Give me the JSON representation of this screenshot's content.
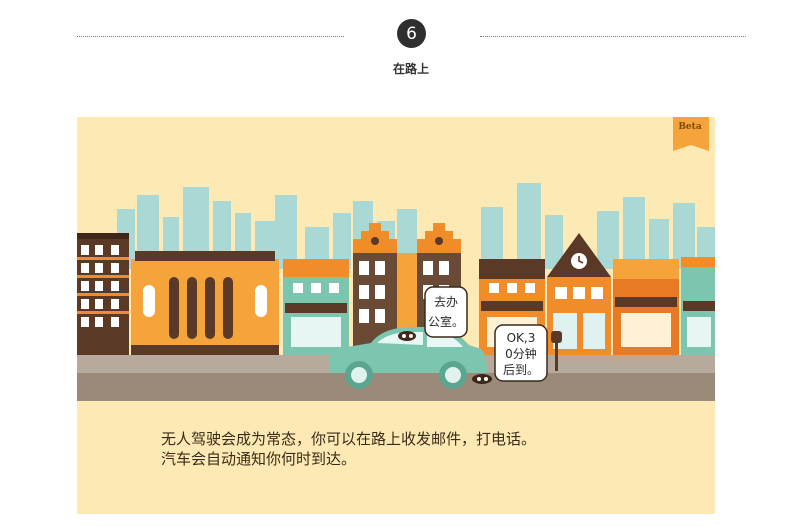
{
  "section": {
    "number": "6",
    "title": "在路上"
  },
  "scene": {
    "badge": "Beta",
    "bubble_left": "去办\n公室。",
    "bubble_right": "OK,3\n0分钟\n后到。",
    "caption_line1": "无人驾驶会成为常态，你可以在路上收发邮件，打电话。",
    "caption_line2": "汽车会自动通知你何时到达。"
  },
  "colors": {
    "background": "#fde9b3",
    "skyline": "#a9d8d5",
    "orange": "#f08c2a",
    "brown": "#5a3a26",
    "car": "#7cc6b0",
    "road": "#9b8a7a"
  }
}
